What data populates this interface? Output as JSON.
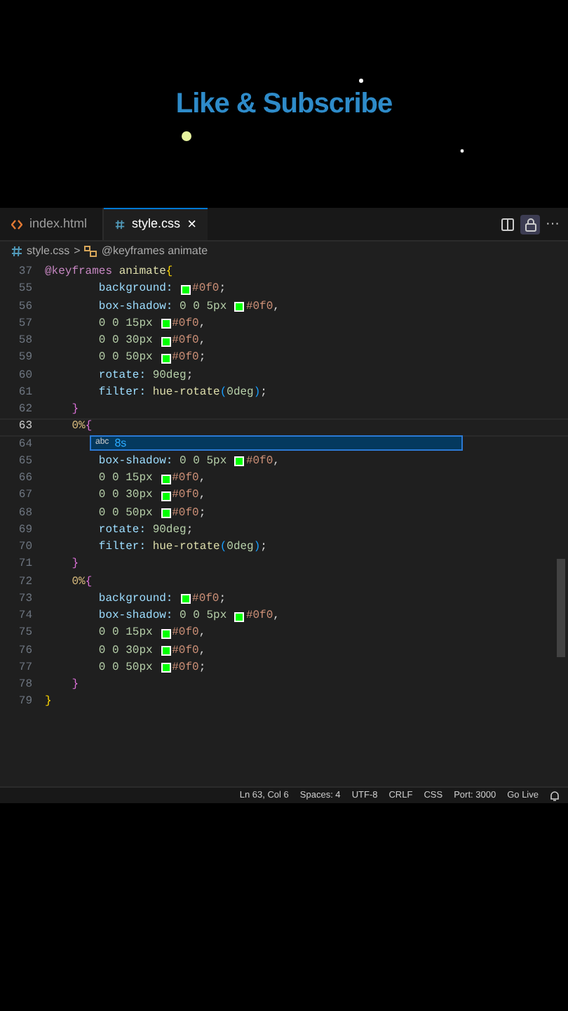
{
  "overlay": {
    "title": "Like & Subscribe"
  },
  "tabs": [
    {
      "label": "index.html",
      "selected": false
    },
    {
      "label": "style.css",
      "selected": true,
      "close": "×"
    }
  ],
  "toolbar": {
    "more": "···",
    "lock_on": true
  },
  "breadcrumb": {
    "file": "style.css",
    "separator": ">",
    "symbol": "@keyframes animate"
  },
  "lines": [
    {
      "number": "37",
      "current": false,
      "tokens": [
        {
          "kind": "keyword",
          "text": "@keyframes"
        },
        {
          "kind": "name",
          "text": " animate"
        },
        {
          "kind": "brace",
          "text": "{",
          "color": "#ffd700"
        }
      ]
    },
    {
      "number": "55",
      "current": false,
      "tokens": [
        {
          "kind": "property",
          "text": "        background: "
        },
        {
          "kind": "swatch",
          "color": "#00ff00"
        },
        {
          "kind": "hex",
          "text": "#0f0"
        },
        {
          "kind": "plain",
          "text": ";"
        }
      ]
    },
    {
      "number": "56",
      "current": false,
      "tokens": [
        {
          "kind": "property",
          "text": "        box-shadow:"
        },
        {
          "kind": "number",
          "text": " 0 0 5px "
        },
        {
          "kind": "swatch",
          "color": "#00ff00"
        },
        {
          "kind": "hex",
          "text": "#0f0"
        },
        {
          "kind": "plain",
          "text": ","
        }
      ]
    },
    {
      "number": "57",
      "current": false,
      "tokens": [
        {
          "kind": "number",
          "text": "        0 0 15px "
        },
        {
          "kind": "swatch",
          "color": "#00ff00"
        },
        {
          "kind": "hex",
          "text": "#0f0"
        },
        {
          "kind": "plain",
          "text": ","
        }
      ]
    },
    {
      "number": "58",
      "current": false,
      "tokens": [
        {
          "kind": "number",
          "text": "        0 0 30px "
        },
        {
          "kind": "swatch",
          "color": "#00ff00"
        },
        {
          "kind": "hex",
          "text": "#0f0"
        },
        {
          "kind": "plain",
          "text": ","
        }
      ]
    },
    {
      "number": "59",
      "current": false,
      "tokens": [
        {
          "kind": "number",
          "text": "        0 0 50px "
        },
        {
          "kind": "swatch",
          "color": "#00ff00"
        },
        {
          "kind": "hex",
          "text": "#0f0"
        },
        {
          "kind": "plain",
          "text": ";"
        }
      ]
    },
    {
      "number": "60",
      "current": false,
      "tokens": [
        {
          "kind": "property",
          "text": "        rotate:"
        },
        {
          "kind": "number",
          "text": " 90deg"
        },
        {
          "kind": "plain",
          "text": ";"
        }
      ]
    },
    {
      "number": "61",
      "current": false,
      "tokens": [
        {
          "kind": "property",
          "text": "        filter:"
        },
        {
          "kind": "name",
          "text": " hue-rotate"
        },
        {
          "kind": "brace",
          "text": "(",
          "color": "#179fff"
        },
        {
          "kind": "number",
          "text": "0deg"
        },
        {
          "kind": "brace",
          "text": ")",
          "color": "#179fff"
        },
        {
          "kind": "plain",
          "text": ";"
        }
      ]
    },
    {
      "number": "62",
      "current": false,
      "tokens": [
        {
          "kind": "brace",
          "text": "    }",
          "color": "#da70d6"
        }
      ]
    },
    {
      "number": "63",
      "current": true,
      "tokens": [
        {
          "kind": "selector",
          "text": "    0%"
        },
        {
          "kind": "brace",
          "text": "{",
          "color": "#da70d6"
        }
      ]
    },
    {
      "number": "64",
      "current": false
    },
    {
      "number": "65",
      "current": false,
      "tokens": [
        {
          "kind": "property",
          "text": "        box-shadow:"
        },
        {
          "kind": "number",
          "text": " 0 0 5px "
        },
        {
          "kind": "swatch",
          "color": "#00ff00"
        },
        {
          "kind": "hex",
          "text": "#0f0"
        },
        {
          "kind": "plain",
          "text": ","
        }
      ]
    },
    {
      "number": "66",
      "current": false,
      "tokens": [
        {
          "kind": "number",
          "text": "        0 0 15px "
        },
        {
          "kind": "swatch",
          "color": "#00ff00"
        },
        {
          "kind": "hex",
          "text": "#0f0"
        },
        {
          "kind": "plain",
          "text": ","
        }
      ]
    },
    {
      "number": "67",
      "current": false,
      "tokens": [
        {
          "kind": "number",
          "text": "        0 0 30px "
        },
        {
          "kind": "swatch",
          "color": "#00ff00"
        },
        {
          "kind": "hex",
          "text": "#0f0"
        },
        {
          "kind": "plain",
          "text": ","
        }
      ]
    },
    {
      "number": "68",
      "current": false,
      "tokens": [
        {
          "kind": "number",
          "text": "        0 0 50px "
        },
        {
          "kind": "swatch",
          "color": "#00ff00"
        },
        {
          "kind": "hex",
          "text": "#0f0"
        },
        {
          "kind": "plain",
          "text": ";"
        }
      ]
    },
    {
      "number": "69",
      "current": false,
      "tokens": [
        {
          "kind": "property",
          "text": "        rotate:"
        },
        {
          "kind": "number",
          "text": " 90deg"
        },
        {
          "kind": "plain",
          "text": ";"
        }
      ]
    },
    {
      "number": "70",
      "current": false,
      "tokens": [
        {
          "kind": "property",
          "text": "        filter:"
        },
        {
          "kind": "name",
          "text": " hue-rotate"
        },
        {
          "kind": "brace",
          "text": "(",
          "color": "#179fff"
        },
        {
          "kind": "number",
          "text": "0deg"
        },
        {
          "kind": "brace",
          "text": ")",
          "color": "#179fff"
        },
        {
          "kind": "plain",
          "text": ";"
        }
      ]
    },
    {
      "number": "71",
      "current": false,
      "tokens": [
        {
          "kind": "brace",
          "text": "    }",
          "color": "#da70d6"
        }
      ]
    },
    {
      "number": "72",
      "current": false,
      "tokens": [
        {
          "kind": "selector",
          "text": "    0%"
        },
        {
          "kind": "brace",
          "text": "{",
          "color": "#da70d6"
        }
      ]
    },
    {
      "number": "73",
      "current": false,
      "tokens": [
        {
          "kind": "property",
          "text": "        background: "
        },
        {
          "kind": "swatch",
          "color": "#00ff00"
        },
        {
          "kind": "hex",
          "text": "#0f0"
        },
        {
          "kind": "plain",
          "text": ";"
        }
      ]
    },
    {
      "number": "74",
      "current": false,
      "tokens": [
        {
          "kind": "property",
          "text": "        box-shadow:"
        },
        {
          "kind": "number",
          "text": " 0 0 5px "
        },
        {
          "kind": "swatch",
          "color": "#00ff00"
        },
        {
          "kind": "hex",
          "text": "#0f0"
        },
        {
          "kind": "plain",
          "text": ","
        }
      ]
    },
    {
      "number": "75",
      "current": false,
      "tokens": [
        {
          "kind": "number",
          "text": "        0 0 15px "
        },
        {
          "kind": "swatch",
          "color": "#00ff00"
        },
        {
          "kind": "hex",
          "text": "#0f0"
        },
        {
          "kind": "plain",
          "text": ","
        }
      ]
    },
    {
      "number": "76",
      "current": false,
      "tokens": [
        {
          "kind": "number",
          "text": "        0 0 30px "
        },
        {
          "kind": "swatch",
          "color": "#00ff00"
        },
        {
          "kind": "hex",
          "text": "#0f0"
        },
        {
          "kind": "plain",
          "text": ","
        }
      ]
    },
    {
      "number": "77",
      "current": false,
      "tokens": [
        {
          "kind": "number",
          "text": "        0 0 50px "
        },
        {
          "kind": "swatch",
          "color": "#00ff00"
        },
        {
          "kind": "hex",
          "text": "#0f0"
        },
        {
          "kind": "plain",
          "text": ";"
        }
      ]
    },
    {
      "number": "78",
      "current": false,
      "tokens": [
        {
          "kind": "brace",
          "text": "    }",
          "color": "#da70d6"
        }
      ]
    },
    {
      "number": "79",
      "current": false,
      "tokens": [
        {
          "kind": "brace",
          "text": "}",
          "color": "#ffd700"
        }
      ]
    }
  ],
  "suggestion": {
    "icon_text": "abc",
    "label": "8s",
    "selected": true
  },
  "status_bar": [
    "Ln 63, Col 6",
    "Spaces: 4",
    "UTF-8",
    "CRLF",
    "CSS",
    "Port: 3000",
    "Go Live"
  ]
}
